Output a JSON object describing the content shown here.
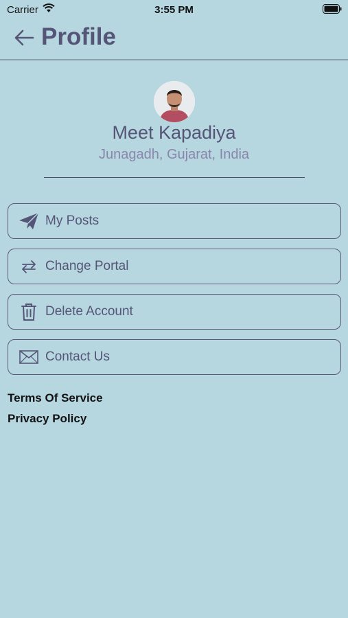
{
  "status_bar": {
    "carrier": "Carrier",
    "time": "3:55 PM",
    "wifi_icon": "wifi-icon",
    "battery_icon": "battery-icon"
  },
  "header": {
    "title": "Profile",
    "back_icon": "arrow-left-icon"
  },
  "profile": {
    "name": "Meet Kapadiya",
    "location": "Junagadh, Gujarat, India",
    "avatar_icon": "avatar"
  },
  "menu": {
    "items": [
      {
        "label": "My Posts",
        "icon": "paper-plane-icon"
      },
      {
        "label": "Change Portal",
        "icon": "swap-arrows-icon"
      },
      {
        "label": "Delete Account",
        "icon": "trash-icon"
      },
      {
        "label": "Contact Us",
        "icon": "envelope-icon"
      }
    ]
  },
  "links": {
    "terms": "Terms Of Service",
    "privacy": "Privacy Policy"
  },
  "colors": {
    "background": "#b6d6e0",
    "primary_text": "#555577",
    "secondary_text": "#8a86ab",
    "border": "#5a5a78"
  }
}
